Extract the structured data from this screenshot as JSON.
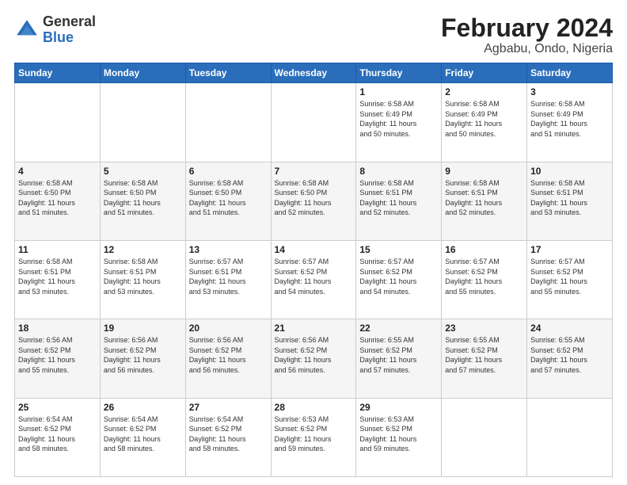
{
  "logo": {
    "general": "General",
    "blue": "Blue"
  },
  "header": {
    "month": "February 2024",
    "location": "Agbabu, Ondo, Nigeria"
  },
  "days_of_week": [
    "Sunday",
    "Monday",
    "Tuesday",
    "Wednesday",
    "Thursday",
    "Friday",
    "Saturday"
  ],
  "weeks": [
    [
      {
        "day": "",
        "info": ""
      },
      {
        "day": "",
        "info": ""
      },
      {
        "day": "",
        "info": ""
      },
      {
        "day": "",
        "info": ""
      },
      {
        "day": "1",
        "info": "Sunrise: 6:58 AM\nSunset: 6:49 PM\nDaylight: 11 hours\nand 50 minutes."
      },
      {
        "day": "2",
        "info": "Sunrise: 6:58 AM\nSunset: 6:49 PM\nDaylight: 11 hours\nand 50 minutes."
      },
      {
        "day": "3",
        "info": "Sunrise: 6:58 AM\nSunset: 6:49 PM\nDaylight: 11 hours\nand 51 minutes."
      }
    ],
    [
      {
        "day": "4",
        "info": "Sunrise: 6:58 AM\nSunset: 6:50 PM\nDaylight: 11 hours\nand 51 minutes."
      },
      {
        "day": "5",
        "info": "Sunrise: 6:58 AM\nSunset: 6:50 PM\nDaylight: 11 hours\nand 51 minutes."
      },
      {
        "day": "6",
        "info": "Sunrise: 6:58 AM\nSunset: 6:50 PM\nDaylight: 11 hours\nand 51 minutes."
      },
      {
        "day": "7",
        "info": "Sunrise: 6:58 AM\nSunset: 6:50 PM\nDaylight: 11 hours\nand 52 minutes."
      },
      {
        "day": "8",
        "info": "Sunrise: 6:58 AM\nSunset: 6:51 PM\nDaylight: 11 hours\nand 52 minutes."
      },
      {
        "day": "9",
        "info": "Sunrise: 6:58 AM\nSunset: 6:51 PM\nDaylight: 11 hours\nand 52 minutes."
      },
      {
        "day": "10",
        "info": "Sunrise: 6:58 AM\nSunset: 6:51 PM\nDaylight: 11 hours\nand 53 minutes."
      }
    ],
    [
      {
        "day": "11",
        "info": "Sunrise: 6:58 AM\nSunset: 6:51 PM\nDaylight: 11 hours\nand 53 minutes."
      },
      {
        "day": "12",
        "info": "Sunrise: 6:58 AM\nSunset: 6:51 PM\nDaylight: 11 hours\nand 53 minutes."
      },
      {
        "day": "13",
        "info": "Sunrise: 6:57 AM\nSunset: 6:51 PM\nDaylight: 11 hours\nand 53 minutes."
      },
      {
        "day": "14",
        "info": "Sunrise: 6:57 AM\nSunset: 6:52 PM\nDaylight: 11 hours\nand 54 minutes."
      },
      {
        "day": "15",
        "info": "Sunrise: 6:57 AM\nSunset: 6:52 PM\nDaylight: 11 hours\nand 54 minutes."
      },
      {
        "day": "16",
        "info": "Sunrise: 6:57 AM\nSunset: 6:52 PM\nDaylight: 11 hours\nand 55 minutes."
      },
      {
        "day": "17",
        "info": "Sunrise: 6:57 AM\nSunset: 6:52 PM\nDaylight: 11 hours\nand 55 minutes."
      }
    ],
    [
      {
        "day": "18",
        "info": "Sunrise: 6:56 AM\nSunset: 6:52 PM\nDaylight: 11 hours\nand 55 minutes."
      },
      {
        "day": "19",
        "info": "Sunrise: 6:56 AM\nSunset: 6:52 PM\nDaylight: 11 hours\nand 56 minutes."
      },
      {
        "day": "20",
        "info": "Sunrise: 6:56 AM\nSunset: 6:52 PM\nDaylight: 11 hours\nand 56 minutes."
      },
      {
        "day": "21",
        "info": "Sunrise: 6:56 AM\nSunset: 6:52 PM\nDaylight: 11 hours\nand 56 minutes."
      },
      {
        "day": "22",
        "info": "Sunrise: 6:55 AM\nSunset: 6:52 PM\nDaylight: 11 hours\nand 57 minutes."
      },
      {
        "day": "23",
        "info": "Sunrise: 6:55 AM\nSunset: 6:52 PM\nDaylight: 11 hours\nand 57 minutes."
      },
      {
        "day": "24",
        "info": "Sunrise: 6:55 AM\nSunset: 6:52 PM\nDaylight: 11 hours\nand 57 minutes."
      }
    ],
    [
      {
        "day": "25",
        "info": "Sunrise: 6:54 AM\nSunset: 6:52 PM\nDaylight: 11 hours\nand 58 minutes."
      },
      {
        "day": "26",
        "info": "Sunrise: 6:54 AM\nSunset: 6:52 PM\nDaylight: 11 hours\nand 58 minutes."
      },
      {
        "day": "27",
        "info": "Sunrise: 6:54 AM\nSunset: 6:52 PM\nDaylight: 11 hours\nand 58 minutes."
      },
      {
        "day": "28",
        "info": "Sunrise: 6:53 AM\nSunset: 6:52 PM\nDaylight: 11 hours\nand 59 minutes."
      },
      {
        "day": "29",
        "info": "Sunrise: 6:53 AM\nSunset: 6:52 PM\nDaylight: 11 hours\nand 59 minutes."
      },
      {
        "day": "",
        "info": ""
      },
      {
        "day": "",
        "info": ""
      }
    ]
  ]
}
